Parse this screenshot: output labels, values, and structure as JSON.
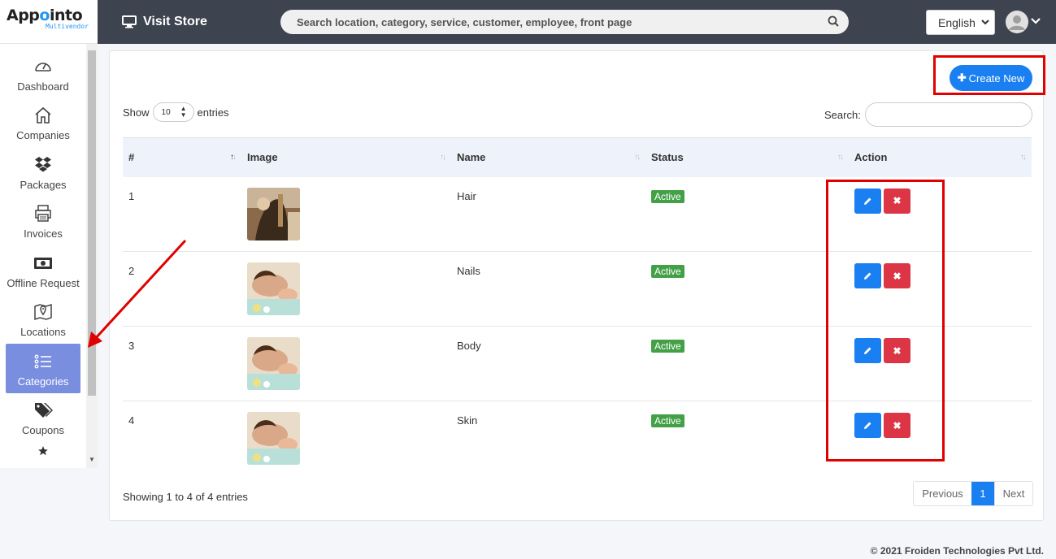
{
  "brand": {
    "name_prefix": "App",
    "name_o": "o",
    "name_suffix": "into",
    "sub": "Multivendor"
  },
  "sidebar": {
    "items": [
      {
        "label": "Dashboard",
        "icon": "dashboard-icon"
      },
      {
        "label": "Companies",
        "icon": "home-icon"
      },
      {
        "label": "Packages",
        "icon": "dropbox-icon"
      },
      {
        "label": "Invoices",
        "icon": "printer-icon"
      },
      {
        "label": "Offline Request",
        "icon": "money-bill-icon"
      },
      {
        "label": "Locations",
        "icon": "map-marker-icon"
      },
      {
        "label": "Categories",
        "icon": "list-icon",
        "active": true
      },
      {
        "label": "Coupons",
        "icon": "tags-icon"
      },
      {
        "label": "",
        "icon": "star-icon"
      }
    ]
  },
  "topbar": {
    "visit_store": "Visit Store",
    "search_placeholder": "Search location, category, service, customer, employee, front page",
    "language": "English"
  },
  "toolbar": {
    "create_label": "Create New"
  },
  "table_controls": {
    "show_label": "Show",
    "show_value": "10",
    "entries_label": "entries",
    "search_label": "Search:"
  },
  "table": {
    "columns": [
      "#",
      "Image",
      "Name",
      "Status",
      "Action"
    ],
    "rows": [
      {
        "num": "1",
        "name": "Hair",
        "status": "Active",
        "image": "hair-image"
      },
      {
        "num": "2",
        "name": "Nails",
        "status": "Active",
        "image": "spa-image"
      },
      {
        "num": "3",
        "name": "Body",
        "status": "Active",
        "image": "spa-image"
      },
      {
        "num": "4",
        "name": "Skin",
        "status": "Active",
        "image": "spa-image"
      }
    ]
  },
  "pagination": {
    "info": "Showing 1 to 4 of 4 entries",
    "prev": "Previous",
    "current": "1",
    "next": "Next"
  },
  "footer": {
    "copyright": "© 2021 Froiden Technologies Pvt Ltd."
  },
  "colors": {
    "topbar": "#3d434f",
    "accent": "#1a7ff0",
    "active_badge": "#43a047",
    "danger": "#dc3545",
    "sidebar_active": "#7a8ee0",
    "annotation": "#e00000"
  }
}
